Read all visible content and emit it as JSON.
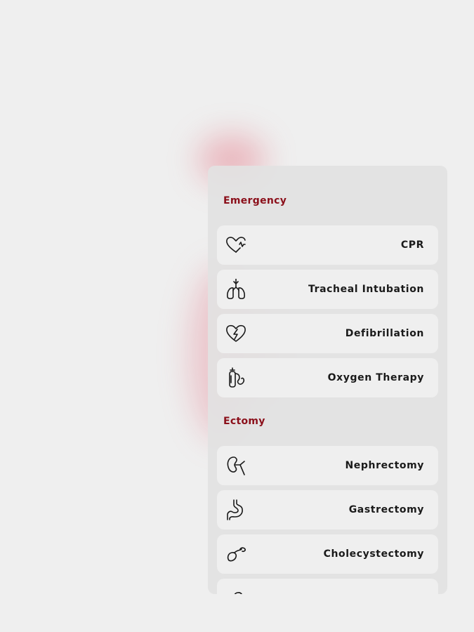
{
  "theme": {
    "section_color": "#8b0f1a"
  },
  "sections": [
    {
      "title": "Emergency",
      "items": [
        {
          "label": "CPR",
          "icon": "heart-pulse-icon"
        },
        {
          "label": "Tracheal Intubation",
          "icon": "lungs-icon"
        },
        {
          "label": "Defibrillation",
          "icon": "heart-bolt-icon"
        },
        {
          "label": "Oxygen Therapy",
          "icon": "oxygen-tank-icon"
        }
      ]
    },
    {
      "title": "Ectomy",
      "items": [
        {
          "label": "Nephrectomy",
          "icon": "kidney-icon"
        },
        {
          "label": "Gastrectomy",
          "icon": "stomach-icon"
        },
        {
          "label": "Cholecystectomy",
          "icon": "gallbladder-icon"
        },
        {
          "label": "",
          "icon": "organ-icon"
        }
      ]
    }
  ]
}
